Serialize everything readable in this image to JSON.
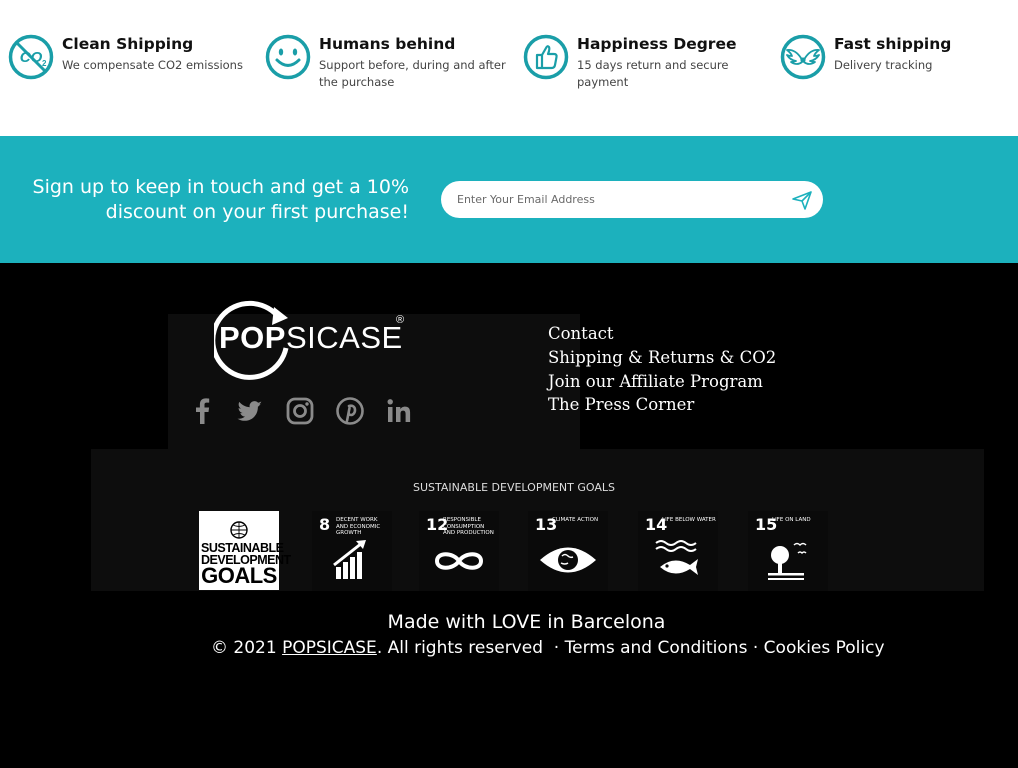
{
  "features": [
    {
      "title": "Clean Shipping",
      "desc": "We compensate CO2 emissions",
      "icon": "co2-crossed-icon"
    },
    {
      "title": "Humans behind",
      "desc1": "Support before, during and after",
      "desc2": "the purchase",
      "icon": "smiley-icon"
    },
    {
      "title": "Happiness Degree",
      "desc1": "15 days return and secure",
      "desc2": "payment",
      "icon": "thumbs-up-icon"
    },
    {
      "title": "Fast shipping",
      "desc": "Delivery tracking",
      "icon": "winged-shipping-icon"
    }
  ],
  "signup": {
    "line1": "Sign up to keep in touch and get a 10%",
    "line2": "discount on your first purchase!",
    "placeholder": "Enter Your Email Address"
  },
  "brand": {
    "logo_bold": "POP",
    "logo_rest": "SICASE",
    "registered": "®"
  },
  "footer_links": [
    "Contact",
    "Shipping & Returns & CO2",
    "Join our Affiliate Program",
    "The Press Corner"
  ],
  "sdg": {
    "title": "SUSTAINABLE DEVELOPMENT GOALS",
    "logo_lines": [
      "SUSTAINABLE",
      "DEVELOPMENT",
      "GOALS"
    ],
    "tiles": [
      {
        "num": "8",
        "caption": "Decent work and economic growth"
      },
      {
        "num": "12",
        "caption": "Responsible consumption and production"
      },
      {
        "num": "13",
        "caption": "Climate action"
      },
      {
        "num": "14",
        "caption": "Life below water"
      },
      {
        "num": "15",
        "caption": "Life on land"
      }
    ]
  },
  "bottom": {
    "made": "Made with LOVE in Barcelona",
    "copy_prefix": "© 2021 ",
    "brand_link": "POPSICASE",
    "copy_suffix": ". All rights reserved  · ",
    "terms": "Terms and Conditions",
    "sep": " · ",
    "cookies": "Cookies Policy"
  },
  "colors": {
    "accent": "#1cb1bd",
    "icon_teal": "#1a9ea8"
  }
}
